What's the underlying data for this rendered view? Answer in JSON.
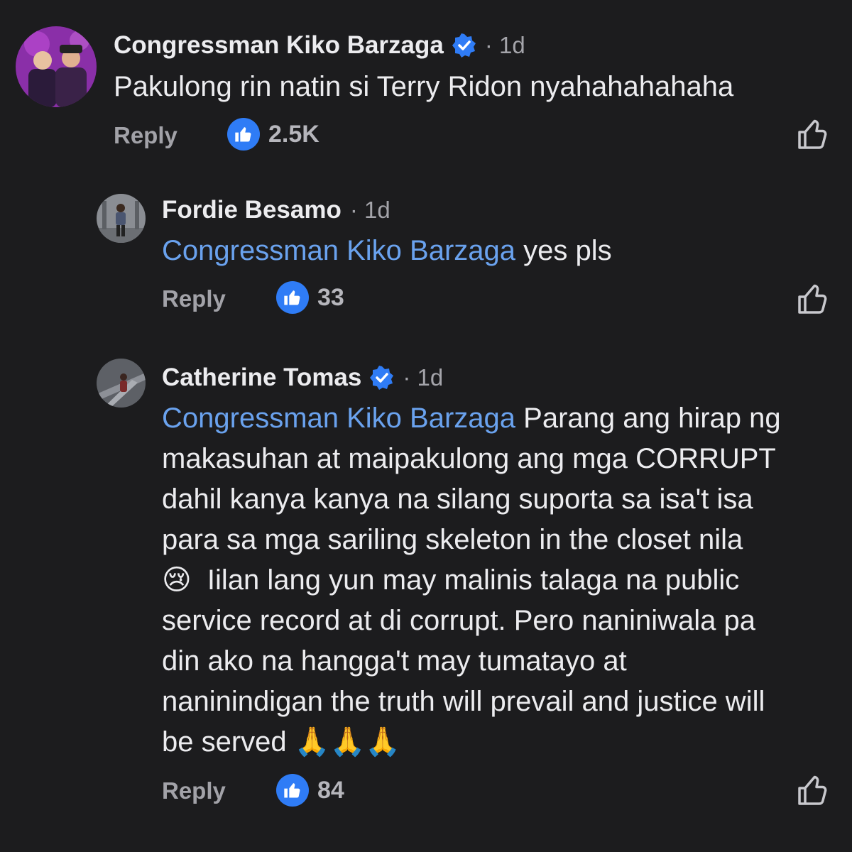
{
  "comments": [
    {
      "author": "Congressman Kiko Barzaga",
      "verified": true,
      "time": "· 1d",
      "mention": "",
      "text": "Pakulong rin natin si Terry Ridon nyahahahahaha",
      "reply_label": "Reply",
      "like_count": "2.5K",
      "avatar_icon": "avatar-photo"
    },
    {
      "author": "Fordie Besamo",
      "verified": false,
      "time": "· 1d",
      "mention": "Congressman Kiko Barzaga",
      "text": " yes pls",
      "reply_label": "Reply",
      "like_count": "33",
      "avatar_icon": "avatar-photo"
    },
    {
      "author": "Catherine Tomas",
      "verified": true,
      "time": "· 1d",
      "mention": "Congressman Kiko Barzaga",
      "text": " Parang ang hirap ng\nmakasuhan at maipakulong ang mga CORRUPT\ndahil kanya kanya na silang suporta sa isa't isa\npara sa mga sariling skeleton in the closet nila\n😢  Iilan lang yun may malinis talaga na public\nservice record at di corrupt. Pero naniniwala pa\ndin ako na hangga't may tumatayo at\nnaninindigan the truth will prevail and justice will\nbe served 🙏🙏🙏",
      "reply_label": "Reply",
      "like_count": "84",
      "avatar_icon": "avatar-photo"
    }
  ],
  "colors": {
    "background": "#1c1c1e",
    "mention": "#6aa2ee",
    "like_badge": "#2f7cf6",
    "verified": "#2f7cf6"
  },
  "icons": {
    "like_badge": "thumbs-up-icon",
    "like_button": "thumbs-up-outline-icon",
    "verified": "verified-badge-icon"
  }
}
